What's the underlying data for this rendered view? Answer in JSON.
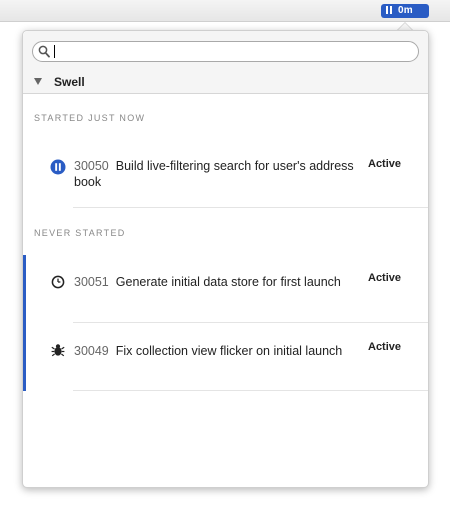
{
  "timer": {
    "label": "0m"
  },
  "search": {
    "value": "",
    "placeholder": ""
  },
  "project": {
    "name": "Swell"
  },
  "sections": [
    {
      "header": "Started just now",
      "tasks": [
        {
          "id": "30050",
          "title": "Build live-filtering search for user's address book",
          "status": "Active",
          "icon": "pause-icon"
        }
      ]
    },
    {
      "header": "Never started",
      "tasks": [
        {
          "id": "30051",
          "title": "Generate initial data store for first launch",
          "status": "Active",
          "icon": "clock-icon"
        },
        {
          "id": "30049",
          "title": "Fix collection view flicker on initial launch",
          "status": "Active",
          "icon": "bug-icon"
        }
      ]
    }
  ],
  "colors": {
    "accent": "#2a5cc4",
    "toolbar": "#f5f5f5",
    "section_text": "#888888"
  }
}
